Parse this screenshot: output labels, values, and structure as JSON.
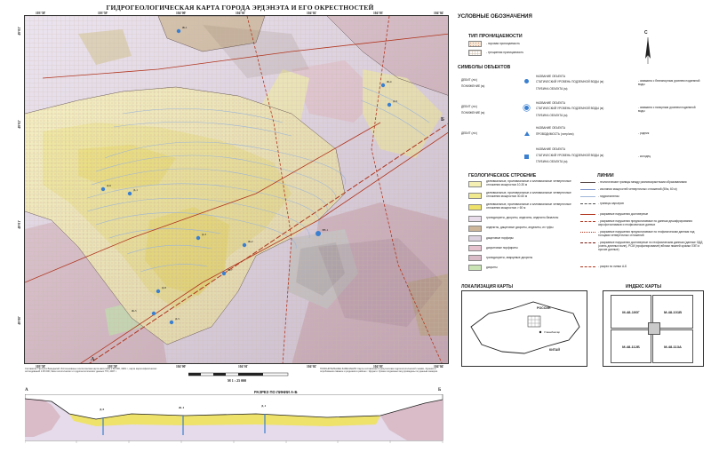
{
  "map": {
    "title": "ГИДРОГЕОЛОГИЧЕСКАЯ КАРТА ГОРОДА ЭРДЭНЭТА И ЕГО ОКРЕСТНОСТЕЙ",
    "top_coords": [
      "103°58'",
      "103°59'",
      "104°00'",
      "104°01'",
      "104°02'",
      "104°03'",
      "104°04'"
    ],
    "bottom_coords": [
      "103°58'",
      "103°59'",
      "104°00'",
      "104°01'",
      "104°02'",
      "104°03'",
      "104°04'"
    ],
    "left_coords": [
      "49°03'",
      "49°02'",
      "49°01'",
      "49°00'"
    ],
    "section_letter_a": "А",
    "section_letter_b": "Б",
    "wells": [
      "Ж-1",
      "Д-6",
      "Д-1",
      "Д-3",
      "Ж-2",
      "Д-8",
      "Д-5",
      "Ж-7",
      "ЭН-1",
      "Ж-4",
      "Д-9",
      "Ж-3"
    ],
    "colors": {
      "yellow_pale": "#f5efb4",
      "yellow_mid": "#f1e98e",
      "yellow_bright": "#eee26a",
      "pink": "#d9bcc8",
      "lilac": "#e5dbea",
      "tan": "#cdb699",
      "green": "#c9e3b4",
      "gray": "#b5b5b5",
      "contour": "#9db5d8",
      "fault": "#b1351e",
      "well": "#3a7fd0"
    }
  },
  "legend": {
    "title": "УСЛОВНЫЕ ОБОЗНАЧЕНИЯ",
    "permeability_title": "ТИП ПРОНИЦАЕМОСТИ",
    "perm_items": [
      "- поровая проницаемость",
      "- трещинная проницаемость"
    ],
    "symbols_title": "СИМБОЛЫ ОБЪЕКТОВ",
    "symbol_rows": [
      {
        "left": "ДЕБИТ (л/с)",
        "left2": "ПОНИЖЕНИЕ (м)",
        "right1": "НАЗВАНИЕ ОБЪЕКТА",
        "right2": "СТАТИЧЕСКИЙ УРОВЕНЬ ПОДЗЕМНОЙ ВОДЫ (м)",
        "right3": "ГЛУБИНА ОБЪЕКТА (м)",
        "desc": "- скважина с безнапорным уровнем подземной воды"
      },
      {
        "left": "ДЕБИТ (л/с)",
        "left2": "ПОНИЖЕНИЕ (м)",
        "right1": "НАЗВАНИЕ ОБЪЕКТА",
        "right2": "СТАТИЧЕСКИЙ УРОВЕНЬ ПОДЗЕМНОЙ ВОДЫ (м)",
        "right3": "ГЛУБИНА ОБЪЕКТА (м)",
        "desc": "- скважина с напорным уровнем подземной воды"
      },
      {
        "left": "ДЕБИТ (л/с)",
        "left2": "",
        "right1": "НАЗВАНИЕ ОБЪЕКТА",
        "right2": "ПРОВОДИМОСТЬ (литр/сек)",
        "right3": "",
        "desc": "- родник"
      },
      {
        "left": "",
        "left2": "",
        "right1": "НАЗВАНИЕ ОБЪЕКТА",
        "right2": "СТАТИЧЕСКИЙ УРОВЕНЬ ПОДЗЕМНОЙ ВОДЫ (м)",
        "right3": "ГЛУБИНА ОБЪЕКТА (м)",
        "desc": "- колодец"
      }
    ],
    "geology_title": "ГЕОЛОГИЧЕСКОЕ СТРОЕНИЕ",
    "geology_items": [
      "делювиальные, пролювиальные и аллювиальные четвертичные отложения мощностью 10-30 м",
      "делювиальные, пролювиальные и аллювиальные четвертичные отложения мощностью 30-60 м",
      "делювиальные, пролювиальные и аллювиальные четвертичные отложения мощностью > 60 м",
      "гранодиориты, диориты, андезиты, андезито-базальты",
      "андезиты, дацитовые диориты, андезиты, их туфы",
      "дацитовые порфиры",
      "диоритовые порфириты",
      "гранодиориты, кварцевые диориты",
      "диориты"
    ],
    "lines_title": "ЛИНИИ",
    "line_items": [
      "- геологические границы между разновозрастными образованиями",
      "- изолинии мощностей четвертичных отложений (50м, 60 м)",
      "- гидроизогипсы",
      "- границы карьеров",
      "- разрывные нарушения достоверные",
      "- разрывные нарушения предполагаемые по данным дешифрирования аэрофотоснимков и геофизических данных",
      "- разрывные нарушения предполагаемые по геофизическим данным под толщами четвертичных отложений",
      "- разрывные нарушения достоверные по геофизическим данным (данные ОДД (очень длинных волн), РСМ (профилирование) вблизи нижней кромки ЛЭП и прочие данные)",
      "- разрез по линии А-Б"
    ]
  },
  "location_inset": {
    "title": "ЛОКАЛИЗАЦИЯ КАРТЫ",
    "label_russia": "РОССИЯ",
    "label_china": "КИТАЙ",
    "label_ub": "Улаанбаатар"
  },
  "index_inset": {
    "title": "ИНДЕКС КАРТЫ",
    "cells": [
      "M-48-100Г",
      "M-48-101В",
      "M-48-112Б",
      "M-48-113А"
    ]
  },
  "scale": {
    "text": "М 1 : 25 000"
  },
  "section": {
    "title": "РАЗРЕЗ ПО ЛИНИИ А-Б",
    "letter_a": "А",
    "letter_b": "Б",
    "wells": [
      "Д-5",
      "Ж-1",
      "Д-1"
    ]
  },
  "notes": {
    "left": "Составила: Гантулга Баяндалай. Использованы геологическая карта масштаба 1:50 000, 1981 г., карта аэрогеофизических исследований 1:25 000; база геологических и гидрогеологических данных ГГЗ, 2007 г.",
    "right": "ПОЯСНИТЕЛЬНЫЕ ЗАМЕЧАНИЯ: Карта составлена по результатам гидрогеологической съёмки, бурения и опробования скважин и родников в районе г. Эрдэнэт. Уровни подземных вод приведены по данным замеров."
  },
  "compass": {
    "letter": "С"
  }
}
